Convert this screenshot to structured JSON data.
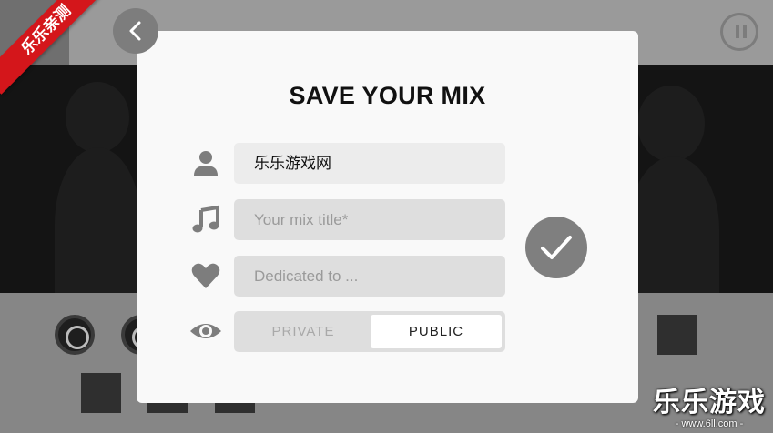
{
  "dialog": {
    "title": "SAVE YOUR MIX",
    "name_value": "乐乐游戏网",
    "mix_title_placeholder": "Your mix title*",
    "dedicated_placeholder": "Dedicated to ...",
    "visibility_options": [
      "PRIVATE",
      "PUBLIC"
    ],
    "visibility_selected": "PUBLIC"
  },
  "icons": {
    "back": "chevron-left-icon",
    "pause": "pause-icon",
    "user": "user-icon",
    "music": "music-note-icon",
    "heart": "heart-icon",
    "eye": "eye-icon",
    "confirm": "checkmark-icon"
  },
  "watermark": {
    "ribbon": "乐乐亲测",
    "brand": "乐乐游戏",
    "url": "- www.6ll.com -"
  },
  "colors": {
    "dialog_bg": "#f9f9f9",
    "accent_gray": "#7f7f7f",
    "ribbon_red": "#d4161b"
  }
}
